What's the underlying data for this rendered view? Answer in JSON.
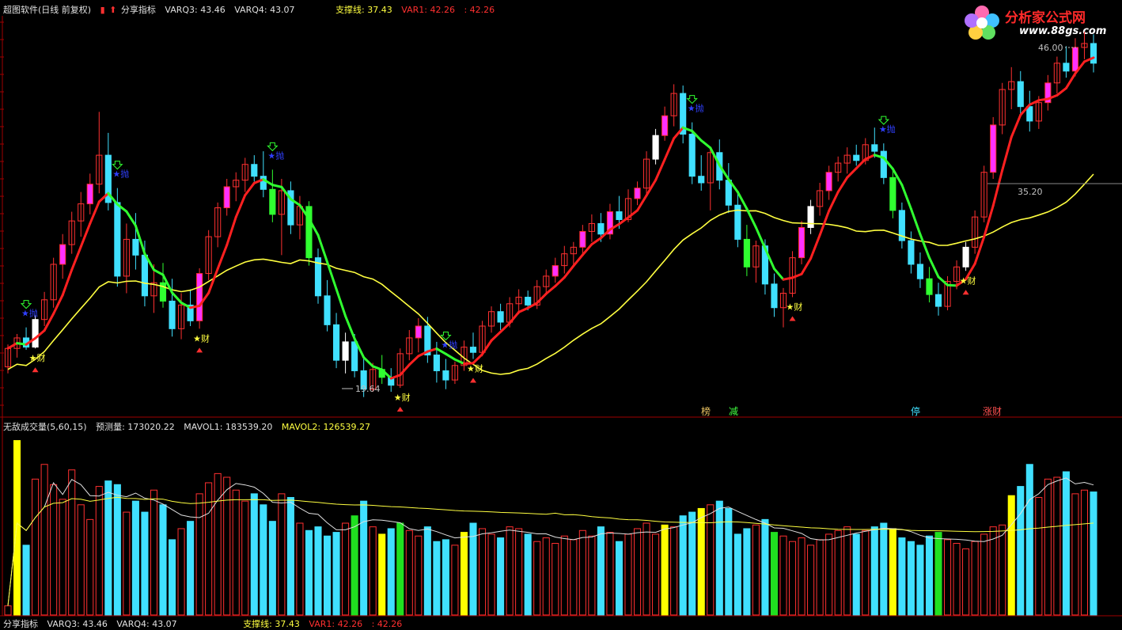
{
  "top_header": {
    "title": "超图软件(日线 前复权)",
    "indicator": "分享指标",
    "varq3": "VARQ3: 43.46",
    "varq4": "VARQ4: 43.07",
    "support": "支撑线: 37.43",
    "var1": "VAR1: 42.26",
    "var1b": ": 42.26"
  },
  "vol_header": {
    "name": "无敌成交量(5,60,15)",
    "forecast": "预测量: 173020.22",
    "mavol1": "MAVOL1: 183539.20",
    "mavol2": "MAVOL2: 126539.27"
  },
  "bottom_header": {
    "indicator": "分享指标",
    "varq3": "VARQ3: 43.46",
    "varq4": "VARQ4: 43.07",
    "support": "支撑线: 37.43",
    "var1": "VAR1: 42.26",
    "var1b": ": 42.26"
  },
  "logo": {
    "name": "分析家公式网",
    "url": "www.88gs.com"
  },
  "price_labels": {
    "high": "46.00",
    "low": "19.64",
    "cursor": "35.20"
  },
  "tags": [
    {
      "text": "榜",
      "color": "#e8c060"
    },
    {
      "text": "减",
      "color": "#40ff40"
    },
    {
      "text": "停",
      "color": "#40e0ff"
    },
    {
      "text": "涨财",
      "color": "#ff5050"
    }
  ],
  "signal_texts": {
    "buy": "★财",
    "sell": "★抛"
  },
  "colors": {
    "up": "#ff3030",
    "down": "#40e0ff",
    "ma_fast": "#ff2020",
    "ma_green": "#30ff30",
    "ma_slow": "#ffff40",
    "magenta": "#ff30ff",
    "vol_yellow": "#ffff00",
    "vol_green": "#20e020"
  },
  "chart_data": [
    {
      "type": "candlestick",
      "n": 120,
      "ohlc": [
        [
          21.5,
          23.2,
          21.0,
          22.9
        ],
        [
          22.9,
          24.0,
          22.2,
          23.7
        ],
        [
          23.7,
          24.5,
          22.8,
          23.0
        ],
        [
          23.0,
          25.4,
          22.9,
          25.1
        ],
        [
          25.1,
          27.2,
          24.6,
          26.6
        ],
        [
          26.6,
          29.8,
          26.0,
          29.3
        ],
        [
          29.3,
          31.6,
          28.2,
          30.8
        ],
        [
          30.8,
          33.3,
          30.1,
          32.6
        ],
        [
          32.6,
          34.8,
          31.4,
          33.9
        ],
        [
          33.9,
          36.2,
          33.1,
          35.4
        ],
        [
          35.4,
          40.9,
          34.7,
          37.6
        ],
        [
          37.6,
          39.3,
          33.4,
          34.0
        ],
        [
          34.0,
          35.1,
          27.6,
          28.4
        ],
        [
          28.4,
          32.4,
          27.1,
          31.2
        ],
        [
          31.2,
          33.2,
          28.9,
          30.0
        ],
        [
          30.0,
          31.1,
          26.1,
          26.9
        ],
        [
          26.9,
          29.3,
          25.6,
          27.9
        ],
        [
          27.9,
          29.4,
          26.0,
          26.5
        ],
        [
          26.5,
          28.2,
          23.8,
          24.4
        ],
        [
          24.4,
          27.1,
          23.6,
          26.2
        ],
        [
          26.2,
          27.4,
          24.6,
          25.0
        ],
        [
          25.0,
          29.0,
          24.4,
          28.6
        ],
        [
          28.6,
          31.9,
          28.1,
          31.4
        ],
        [
          31.4,
          34.0,
          30.6,
          33.6
        ],
        [
          33.6,
          35.8,
          33.0,
          35.2
        ],
        [
          35.2,
          36.3,
          34.1,
          35.7
        ],
        [
          35.7,
          37.4,
          34.8,
          36.9
        ],
        [
          36.9,
          37.6,
          35.6,
          36.0
        ],
        [
          36.0,
          37.9,
          34.4,
          35.0
        ],
        [
          35.0,
          36.5,
          32.5,
          33.1
        ],
        [
          33.1,
          35.8,
          30.0,
          34.9
        ],
        [
          34.9,
          35.6,
          31.6,
          32.3
        ],
        [
          32.3,
          34.5,
          31.2,
          33.7
        ],
        [
          33.7,
          34.1,
          29.2,
          29.8
        ],
        [
          29.8,
          30.5,
          26.3,
          26.9
        ],
        [
          26.9,
          28.1,
          24.2,
          24.7
        ],
        [
          24.7,
          25.6,
          21.4,
          22.0
        ],
        [
          22.0,
          24.1,
          21.0,
          23.4
        ],
        [
          23.4,
          24.0,
          20.7,
          21.2
        ],
        [
          21.2,
          22.1,
          19.2,
          19.8
        ],
        [
          19.8,
          21.8,
          19.6,
          21.3
        ],
        [
          21.3,
          22.4,
          20.2,
          20.7
        ],
        [
          20.7,
          21.4,
          19.6,
          20.1
        ],
        [
          20.1,
          22.9,
          19.9,
          22.5
        ],
        [
          22.5,
          24.3,
          22.0,
          23.7
        ],
        [
          23.7,
          25.2,
          22.6,
          24.6
        ],
        [
          24.6,
          25.3,
          21.8,
          22.4
        ],
        [
          22.4,
          23.4,
          20.3,
          21.2
        ],
        [
          21.2,
          22.1,
          19.8,
          20.5
        ],
        [
          20.5,
          21.9,
          20.2,
          21.6
        ],
        [
          21.6,
          23.5,
          21.2,
          23.0
        ],
        [
          23.0,
          24.1,
          22.1,
          22.6
        ],
        [
          22.6,
          25.0,
          22.3,
          24.6
        ],
        [
          24.6,
          26.1,
          24.1,
          25.7
        ],
        [
          25.7,
          26.3,
          24.3,
          24.9
        ],
        [
          24.9,
          26.8,
          24.5,
          26.3
        ],
        [
          26.3,
          27.4,
          25.5,
          26.8
        ],
        [
          26.8,
          27.3,
          25.8,
          26.2
        ],
        [
          26.2,
          28.1,
          25.9,
          27.6
        ],
        [
          27.6,
          28.9,
          27.0,
          28.4
        ],
        [
          28.4,
          29.8,
          27.9,
          29.2
        ],
        [
          29.2,
          30.7,
          28.6,
          30.1
        ],
        [
          30.1,
          31.0,
          29.1,
          30.6
        ],
        [
          30.6,
          32.3,
          30.0,
          31.8
        ],
        [
          31.8,
          33.1,
          31.0,
          32.4
        ],
        [
          32.4,
          33.2,
          31.0,
          31.6
        ],
        [
          31.6,
          33.9,
          31.2,
          33.3
        ],
        [
          33.3,
          34.5,
          32.0,
          32.7
        ],
        [
          32.7,
          35.0,
          32.5,
          34.3
        ],
        [
          34.3,
          35.6,
          33.8,
          35.1
        ],
        [
          35.1,
          37.9,
          34.6,
          37.3
        ],
        [
          37.3,
          39.6,
          36.9,
          39.1
        ],
        [
          39.1,
          41.3,
          38.7,
          40.6
        ],
        [
          40.6,
          43.0,
          39.8,
          42.3
        ],
        [
          42.3,
          42.9,
          38.5,
          39.2
        ],
        [
          39.2,
          40.1,
          35.4,
          36.0
        ],
        [
          36.0,
          37.6,
          34.9,
          35.5
        ],
        [
          35.5,
          38.2,
          33.4,
          37.8
        ],
        [
          37.8,
          38.8,
          35.0,
          35.7
        ],
        [
          35.7,
          37.0,
          33.2,
          33.8
        ],
        [
          33.8,
          34.7,
          30.6,
          31.2
        ],
        [
          31.2,
          32.3,
          28.4,
          29.1
        ],
        [
          29.1,
          31.1,
          27.9,
          30.7
        ],
        [
          30.7,
          31.2,
          27.0,
          27.8
        ],
        [
          27.8,
          28.6,
          25.3,
          26.0
        ],
        [
          26.0,
          27.5,
          24.5,
          27.1
        ],
        [
          27.1,
          30.3,
          26.8,
          29.8
        ],
        [
          29.8,
          32.6,
          29.3,
          32.1
        ],
        [
          32.1,
          34.2,
          31.6,
          33.7
        ],
        [
          33.7,
          35.5,
          33.0,
          34.9
        ],
        [
          34.9,
          36.8,
          34.2,
          36.3
        ],
        [
          36.3,
          37.5,
          35.6,
          37.0
        ],
        [
          37.0,
          38.2,
          36.2,
          37.6
        ],
        [
          37.6,
          38.4,
          36.8,
          37.2
        ],
        [
          37.2,
          38.9,
          36.9,
          38.4
        ],
        [
          38.4,
          39.7,
          37.4,
          37.9
        ],
        [
          37.9,
          38.5,
          35.4,
          35.9
        ],
        [
          35.9,
          36.6,
          32.8,
          33.4
        ],
        [
          33.4,
          34.0,
          30.5,
          31.1
        ],
        [
          31.1,
          31.8,
          28.6,
          29.3
        ],
        [
          29.3,
          30.2,
          27.5,
          28.2
        ],
        [
          28.2,
          29.1,
          26.4,
          27.0
        ],
        [
          27.0,
          27.9,
          25.4,
          26.1
        ],
        [
          26.1,
          28.4,
          25.8,
          28.0
        ],
        [
          28.0,
          29.6,
          27.4,
          29.1
        ],
        [
          29.1,
          31.0,
          28.8,
          30.6
        ],
        [
          30.6,
          33.4,
          30.1,
          32.9
        ],
        [
          32.9,
          36.8,
          32.5,
          36.3
        ],
        [
          36.3,
          40.5,
          35.8,
          39.9
        ],
        [
          39.9,
          43.1,
          39.2,
          42.6
        ],
        [
          42.6,
          44.3,
          41.1,
          43.2
        ],
        [
          43.2,
          44.0,
          40.6,
          41.3
        ],
        [
          41.3,
          42.5,
          39.4,
          40.2
        ],
        [
          40.2,
          42.1,
          39.6,
          41.6
        ],
        [
          41.6,
          43.7,
          41.0,
          43.1
        ],
        [
          43.1,
          45.1,
          42.3,
          44.6
        ],
        [
          44.6,
          45.9,
          43.5,
          44.0
        ],
        [
          44.0,
          46.5,
          43.6,
          45.8
        ],
        [
          45.8,
          47.0,
          44.9,
          46.1
        ],
        [
          46.1,
          46.8,
          43.9,
          44.6
        ]
      ],
      "volume": [
        5,
        95,
        38,
        74,
        82,
        71,
        63,
        79,
        60,
        52,
        70,
        73,
        71,
        56,
        62,
        56,
        68,
        60,
        41,
        47,
        51,
        66,
        72,
        77,
        75,
        68,
        62,
        66,
        60,
        51,
        66,
        64,
        50,
        46,
        48,
        43,
        45,
        50,
        54,
        62,
        48,
        44,
        47,
        50,
        46,
        43,
        48,
        40,
        41,
        38,
        45,
        50,
        47,
        44,
        42,
        48,
        47,
        44,
        40,
        42,
        39,
        43,
        41,
        46,
        43,
        48,
        45,
        40,
        44,
        47,
        50,
        44,
        49,
        48,
        54,
        56,
        58,
        60,
        62,
        58,
        44,
        47,
        49,
        52,
        45,
        43,
        40,
        42,
        38,
        41,
        44,
        46,
        48,
        44,
        46,
        48,
        50,
        47,
        42,
        40,
        38,
        43,
        45,
        41,
        39,
        36,
        40,
        44,
        48,
        49,
        65,
        70,
        82,
        64,
        74,
        75,
        78,
        66,
        68,
        67
      ],
      "ylim": [
        19,
        47
      ],
      "vol_ylim": [
        0,
        100
      ]
    }
  ]
}
